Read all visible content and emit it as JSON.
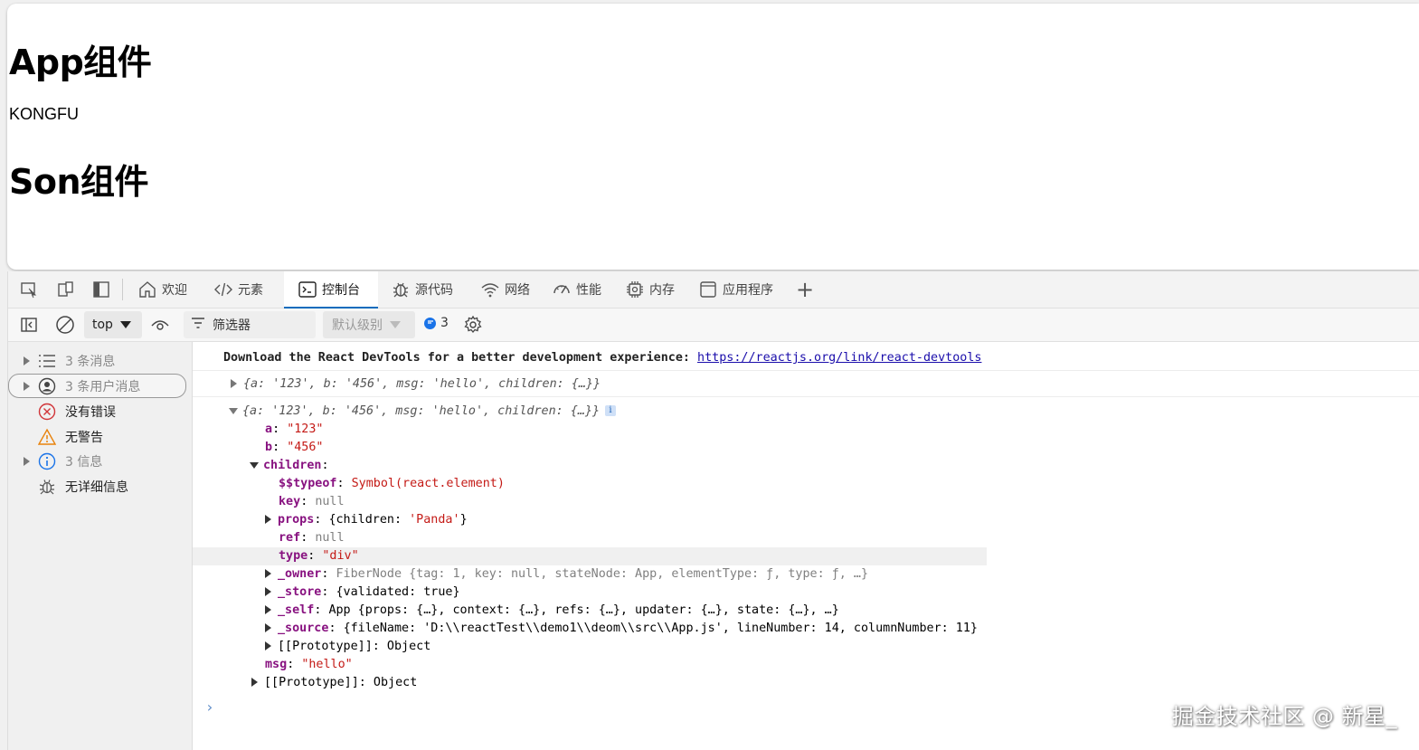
{
  "page": {
    "app_heading": "App组件",
    "text": "KONGFU",
    "son_heading": "Son组件"
  },
  "devtools": {
    "tabs": [
      {
        "label": "欢迎",
        "icon": "home-icon"
      },
      {
        "label": "元素",
        "icon": "code-icon"
      },
      {
        "label": "控制台",
        "icon": "console-icon"
      },
      {
        "label": "源代码",
        "icon": "bug-icon"
      },
      {
        "label": "网络",
        "icon": "wifi-icon"
      },
      {
        "label": "性能",
        "icon": "performance-icon"
      },
      {
        "label": "内存",
        "icon": "memory-chip-icon"
      },
      {
        "label": "应用程序",
        "icon": "application-icon"
      }
    ],
    "active_tab": "控制台",
    "add_tab": "+",
    "toolbar": {
      "context": "top",
      "filter_label": "筛选器",
      "level_label": "默认级别",
      "issues_count": "3"
    },
    "sidebar": [
      {
        "label": "3 条消息",
        "icon": "list-icon",
        "expandable": true
      },
      {
        "label": "3 条用户消息",
        "icon": "user-icon",
        "expandable": true,
        "selected": true
      },
      {
        "label": "没有错误",
        "icon": "error-icon",
        "expandable": false
      },
      {
        "label": "无警告",
        "icon": "warning-icon",
        "expandable": false
      },
      {
        "label": "3 信息",
        "icon": "info-icon",
        "expandable": true
      },
      {
        "label": "无详细信息",
        "icon": "bug-icon",
        "expandable": false
      }
    ],
    "console": {
      "devtools_msg": "Download the React DevTools for a better development experience: ",
      "devtools_link": "https://reactjs.org/link/react-devtools",
      "collapsed_obj": "{a: '123', b: '456', msg: 'hello', children: {…}}",
      "expanded_obj": "{a: '123', b: '456', msg: 'hello', children: {…}}",
      "prop_a_key": "a",
      "prop_a_val": "\"123\"",
      "prop_b_key": "b",
      "prop_b_val": "\"456\"",
      "children_key": "children",
      "typeof_key": "$$typeof",
      "typeof_val": "Symbol(react.element)",
      "key_key": "key",
      "key_val": "null",
      "props_key": "props",
      "props_val_pre": "{children: ",
      "props_val_str": "'Panda'",
      "props_val_post": "}",
      "ref_key": "ref",
      "ref_val": "null",
      "type_key": "type",
      "type_val": "\"div\"",
      "owner_key": "_owner",
      "owner_val": "FiberNode {tag: 1, key: null, stateNode: App, elementType: ƒ, type: ƒ, …}",
      "store_key": "_store",
      "store_val": "{validated: true}",
      "self_key": "_self",
      "self_val": "App {props: {…}, context: {…}, refs: {…}, updater: {…}, state: {…}, …}",
      "source_key": "_source",
      "source_val": "{fileName: 'D:\\\\reactTest\\\\demo1\\\\deom\\\\src\\\\App.js', lineNumber: 14, columnNumber: 11}",
      "proto_inner": "[[Prototype]]: Object",
      "msg_key": "msg",
      "msg_val": "\"hello\"",
      "proto_outer": "[[Prototype]]: Object",
      "prompt": "›"
    }
  },
  "watermark": "掘金技术社区 @ 新星_"
}
